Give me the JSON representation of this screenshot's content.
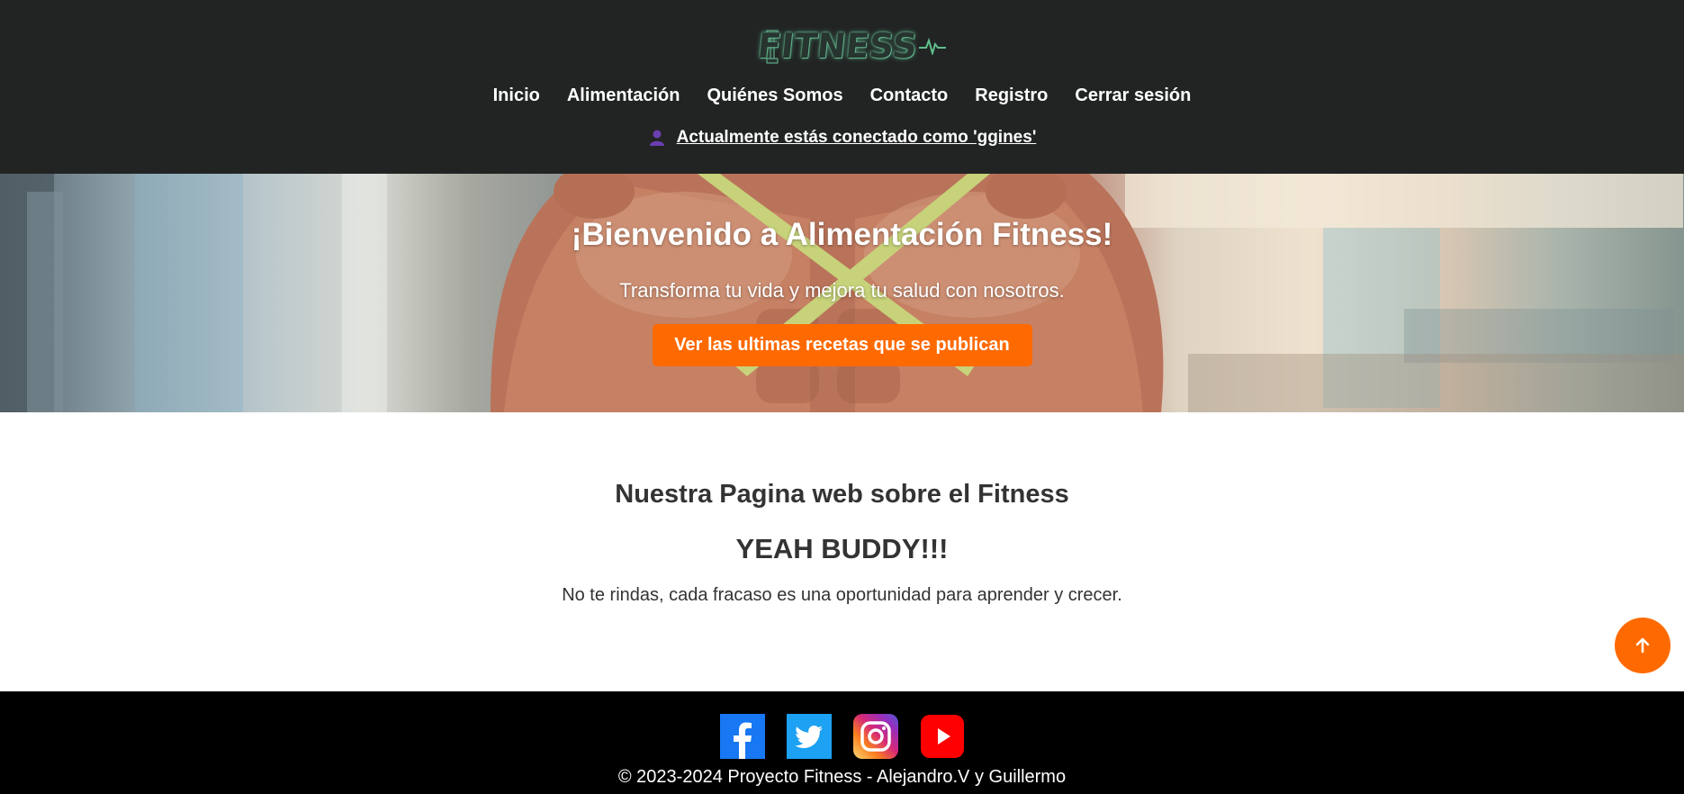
{
  "header": {
    "logo_text": "FITNESS",
    "nav": [
      {
        "label": "Inicio"
      },
      {
        "label": "Alimentación"
      },
      {
        "label": "Quiénes Somos"
      },
      {
        "label": "Contacto"
      },
      {
        "label": "Registro"
      },
      {
        "label": "Cerrar sesión"
      }
    ],
    "user_status": "Actualmente estás conectado como 'ggines'"
  },
  "hero": {
    "title": "¡Bienvenido a Alimentación Fitness!",
    "subtitle": "Transforma tu vida y mejora tu salud con nosotros.",
    "cta_label": "Ver las ultimas recetas que se publican"
  },
  "main": {
    "heading": "Nuestra Pagina web sobre el Fitness",
    "shout": "YEAH BUDDY!!!",
    "quote": "No te rindas, cada fracaso es una oportunidad para aprender y crecer."
  },
  "footer": {
    "social": [
      {
        "icon": "facebook-icon",
        "color": "#1877f2"
      },
      {
        "icon": "twitter-icon",
        "color": "#1da1f2"
      },
      {
        "icon": "instagram-icon",
        "color": "#d62976"
      },
      {
        "icon": "youtube-icon",
        "color": "#ff0000"
      }
    ],
    "copyright": "© 2023-2024 Proyecto Fitness - Alejandro.V y Guillermo"
  },
  "colors": {
    "header_bg": "#222424",
    "accent": "#ff6a00",
    "footer_bg": "#000000"
  }
}
